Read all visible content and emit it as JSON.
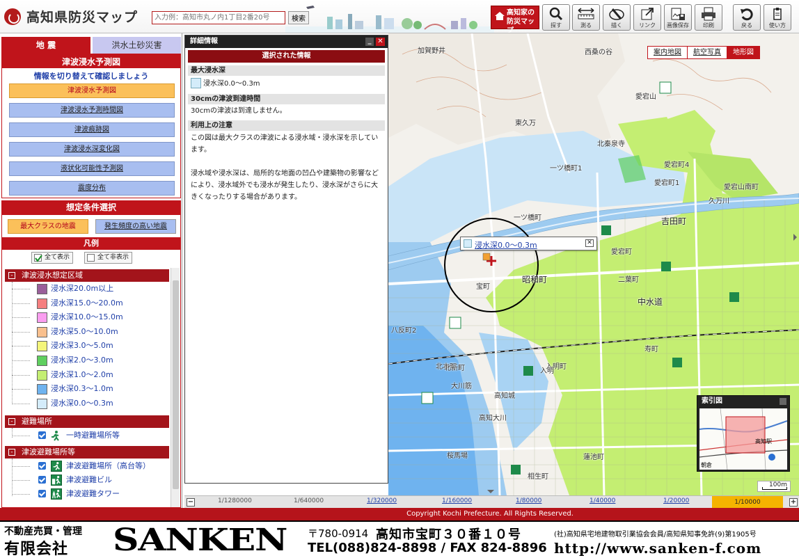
{
  "header": {
    "title": "高知県防災マップ",
    "search_placeholder": "入力例：高知市丸ノ内1丁目2番20号",
    "search_button": "検索",
    "pref_map_line1": "高知家の",
    "pref_map_line2": "防災マップ",
    "tools": [
      {
        "label": "探す",
        "icon": "magnifier-icon"
      },
      {
        "label": "測る",
        "icon": "ruler-icon"
      },
      {
        "label": "描く",
        "icon": "draw-icon"
      },
      {
        "label": "リンク",
        "icon": "link-icon"
      },
      {
        "label": "画像保存",
        "icon": "save-image-icon"
      },
      {
        "label": "印刷",
        "icon": "printer-icon"
      },
      {
        "label": "戻る",
        "icon": "undo-icon"
      },
      {
        "label": "使い方",
        "icon": "help-icon"
      }
    ]
  },
  "left": {
    "tab_quake": "地 震",
    "tab_flood": "洪水土砂災害",
    "hazard_header": "津波浸水予測図",
    "switch_note": "情報を切り替えて確認しましょう",
    "map_buttons": [
      "津波浸水予測図",
      "津波浸水予測時間図",
      "津波痕跡図",
      "津波浸水深変化図",
      "液状化可能性予測図",
      "震度分布"
    ],
    "cond_header": "想定条件選択",
    "cond_max": "最大クラスの地震",
    "cond_freq": "発生頻度の高い地震",
    "legend_header": "凡例",
    "show_all": "全て表示",
    "hide_all": "全て非表示",
    "groups": {
      "tsunami_area": "津波浸水想定区域",
      "shelter": "避難場所",
      "tsunami_shelter": "津波避難場所等"
    },
    "depth_items": [
      {
        "label": "浸水深20.0m以上",
        "color": "#9a5f9a"
      },
      {
        "label": "浸水深15.0～20.0m",
        "color": "#f57f7f"
      },
      {
        "label": "浸水深10.0～15.0m",
        "color": "#fb9ef0"
      },
      {
        "label": "浸水深5.0～10.0m",
        "color": "#f9c08e"
      },
      {
        "label": "浸水深3.0～5.0m",
        "color": "#f4f57a"
      },
      {
        "label": "浸水深2.0～3.0m",
        "color": "#5fcf5f"
      },
      {
        "label": "浸水深1.0～2.0m",
        "color": "#c4ee72"
      },
      {
        "label": "浸水深0.3～1.0m",
        "color": "#6fb3ef"
      },
      {
        "label": "浸水深0.0～0.3m",
        "color": "#d4ecfa"
      }
    ],
    "shelter_items": [
      "一時避難場所等"
    ],
    "tsunami_shelter_items": [
      "津波避難場所（高台等）",
      "津波避難ビル",
      "津波避難タワー"
    ]
  },
  "detail": {
    "title": "詳細情報",
    "selected": "選択された情報",
    "depth_label": "最大浸水深",
    "depth_value": "浸水深0.0～0.3m",
    "arrival_label": "30cmの津波到達時間",
    "arrival_value": "30cmの津波は到達しません。",
    "notes_label": "利用上の注意",
    "notes_value": "この図は最大クラスの津波による浸水域・浸水深を示しています。\n\n浸水域や浸水深は、局所的な地面の凹凸や建築物の影響などにより、浸水域外でも浸水が発生したり、浸水深がさらに大きくなったりする場合があります。"
  },
  "map": {
    "switch": [
      "案内地図",
      "航空写真",
      "地形図"
    ],
    "popup": "浸水深0.0～0.3m",
    "labels": [
      "加賀野井",
      "西桑の谷",
      "東久万",
      "愛宕山",
      "愛宕町4",
      "愛宕町1",
      "北秦泉寺",
      "一ツ橋町1",
      "愛宕山南町",
      "久万川",
      "一ツ橋町",
      "吉田町",
      "中水道",
      "宝町",
      "二葉町",
      "昭和町",
      "八反町2",
      "寿町",
      "愛宕町",
      "入明町",
      "大川筋",
      "高知城",
      "桜馬場",
      "入明",
      "北本町",
      "北新町",
      "高知大川",
      "相生町",
      "蓮池町"
    ],
    "locator_title": "索引図",
    "locator_labels": [
      "高知駅",
      "朝倉"
    ],
    "scale_label": "100m"
  },
  "zoom": {
    "scales": [
      "1/1280000",
      "1/640000",
      "1/320000",
      "1/160000",
      "1/80000",
      "1/40000",
      "1/20000"
    ],
    "current": "1/10000"
  },
  "copyright": "Copyright Kochi Prefecture. All Rights Reserved.",
  "footer": {
    "line1": "不動産売買・管理",
    "line2": "有限会社",
    "brand": "SANKEN",
    "postal": "〒780-0914",
    "address": "高知市宝町３０番１０号",
    "assoc": "(社)高知県宅地建物取引業協会会員/高知県知事免許(9)第1905号",
    "tel": "TEL(088)824-8898 / FAX 824-8896",
    "url": "http://www.sanken-f.com"
  }
}
